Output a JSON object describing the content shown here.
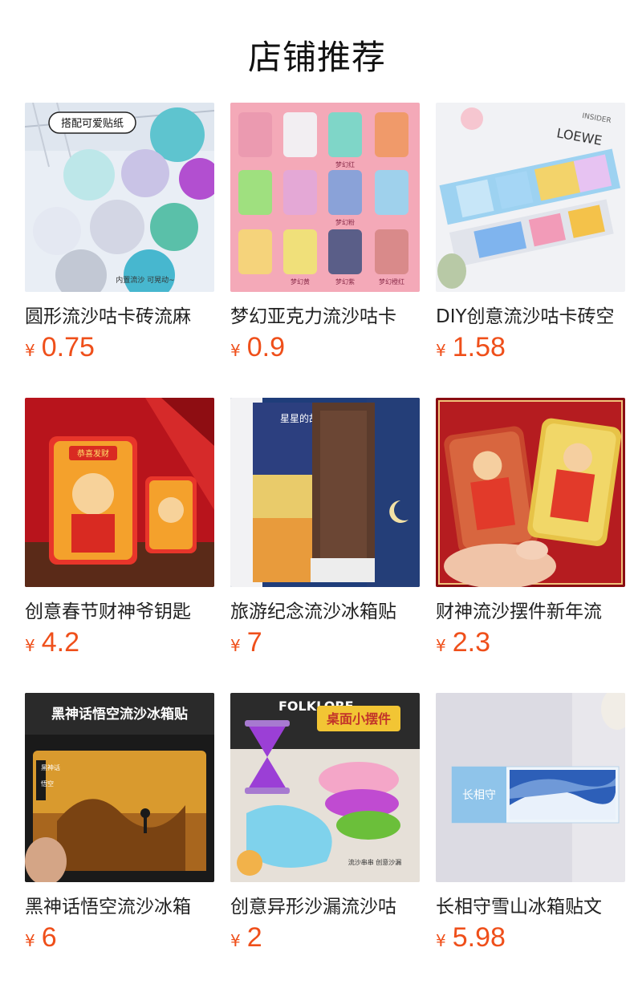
{
  "page": {
    "title": "店铺推荐"
  },
  "currency_symbol": "¥",
  "products": [
    {
      "name": "圆形流沙咕卡砖流麻",
      "price": "0.75",
      "image_text": [
        "搭配可爱贴纸",
        "内置流沙 可晃动~"
      ]
    },
    {
      "name": "梦幻亚克力流沙咕卡",
      "price": "0.9",
      "image_text": [
        "梦幻红",
        "梦幻粉",
        "梦幻紫",
        "梦幻黄",
        "梦幻橙红"
      ]
    },
    {
      "name": "DIY创意流沙咕卡砖空",
      "price": "1.58",
      "image_text": [
        "LOEWE",
        "INSIDER"
      ]
    },
    {
      "name": "创意春节财神爷钥匙",
      "price": "4.2",
      "image_text": [
        "恭喜发财"
      ]
    },
    {
      "name": "旅游纪念流沙冰箱贴",
      "price": "7",
      "image_text": [
        "星星的故乡"
      ]
    },
    {
      "name": "财神流沙摆件新年流",
      "price": "2.3",
      "image_text": []
    },
    {
      "name": "黑神话悟空流沙冰箱",
      "price": "6",
      "image_text": [
        "黑神话悟空流沙冰箱贴",
        "黑神话",
        "悟空"
      ]
    },
    {
      "name": "创意异形沙漏流沙咕",
      "price": "2",
      "image_text": [
        "桌面小摆件",
        "流沙串串 创意沙漏",
        "FOLKLORE"
      ]
    },
    {
      "name": "长相守雪山冰箱贴文",
      "price": "5.98",
      "image_text": [
        "长相守"
      ]
    }
  ],
  "colors": {
    "price": "#ef4f1a",
    "title": "#111111",
    "name": "#222222"
  }
}
